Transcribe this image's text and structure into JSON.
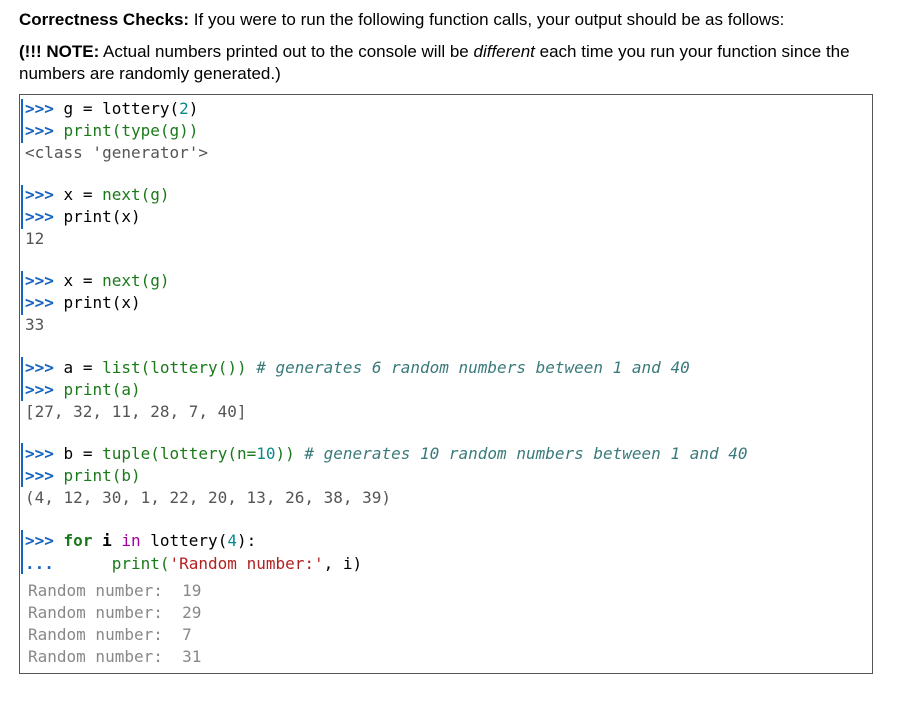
{
  "heading": {
    "label": "Correctness Checks:",
    "text": " If you were to run the following function calls, your output should be as follows:"
  },
  "note": {
    "label": "(!!! NOTE:",
    "text1": " Actual numbers printed out to the console will be ",
    "emph": "different",
    "text2": " each time you run your function since the numbers are randomly generated.)"
  },
  "code": {
    "prompt": ">>>",
    "cont": "...",
    "b1": {
      "l1": {
        "a": "g",
        "eq": " = ",
        "fn": "lottery(",
        "n": "2",
        "close": ")"
      },
      "l2": {
        "fn": "print(type(g))"
      },
      "out": "<class 'generator'>"
    },
    "b2": {
      "l1": {
        "a": "x",
        "eq": " = ",
        "fn": "next(g)"
      },
      "l2": {
        "fn": "print(x)"
      },
      "out": "12"
    },
    "b3": {
      "l1": {
        "a": "x",
        "eq": " = ",
        "fn": "next(g)"
      },
      "l2": {
        "fn": "print(x)"
      },
      "out": "33"
    },
    "b4": {
      "l1": {
        "a": "a",
        "eq": " = ",
        "fn": "list(lottery())",
        "comment": "# generates 6 random numbers between 1 and 40"
      },
      "l2": {
        "fn": "print(a)"
      },
      "out": "[27, 32, 11, 28, 7, 40]"
    },
    "b5": {
      "l1": {
        "a": "b",
        "eq": " = ",
        "fn": "tuple(lottery(n=",
        "n": "10",
        "close": "))",
        "comment": "# generates 10 random numbers between 1 and 40"
      },
      "l2": {
        "fn": "print(b)"
      },
      "out": "(4, 12, 30, 1, 22, 20, 13, 26, 38, 39)"
    },
    "b6": {
      "l1": {
        "kw_for": "for",
        "var": " i ",
        "kw_in": "in",
        "fn": " lottery(",
        "n": "4",
        "close": "):"
      },
      "l2": {
        "fn": "print(",
        "str": "'Random number:'",
        "rest": ", i)"
      },
      "out": [
        "Random number:  19",
        "Random number:  29",
        "Random number:  7",
        "Random number:  31"
      ]
    }
  }
}
